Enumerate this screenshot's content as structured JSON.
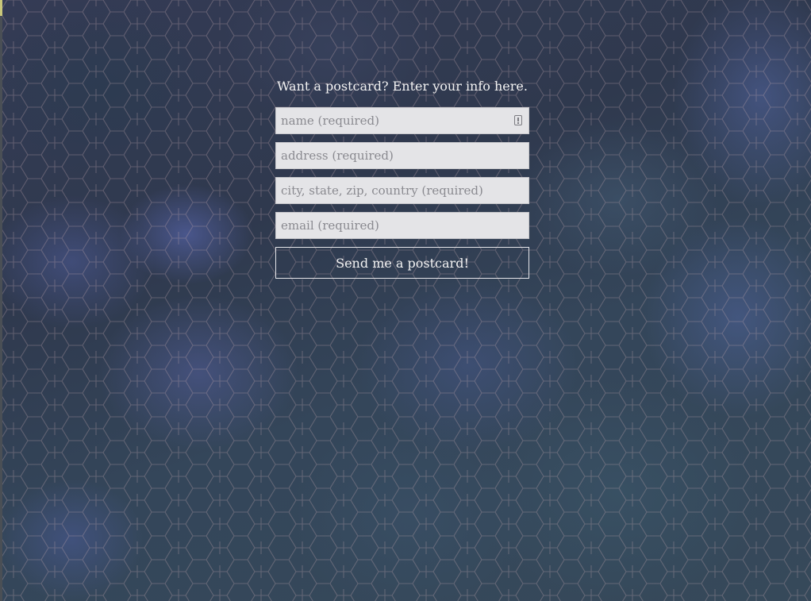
{
  "form": {
    "intro_text": "Want a postcard? Enter your info here.",
    "fields": [
      {
        "placeholder": "name (required)",
        "value": "",
        "has_autofill_icon": true
      },
      {
        "placeholder": "address (required)",
        "value": ""
      },
      {
        "placeholder": "city, state, zip, country (required)",
        "value": ""
      },
      {
        "placeholder": "email (required)",
        "value": ""
      }
    ],
    "submit_label": "Send me a postcard!"
  },
  "icons": {
    "autofill": "contact-card-icon"
  },
  "colors": {
    "background": "#2c3447",
    "input_background": "#e4e4e7",
    "text": "#f2f2f2",
    "button_border": "#e6e6ea"
  }
}
